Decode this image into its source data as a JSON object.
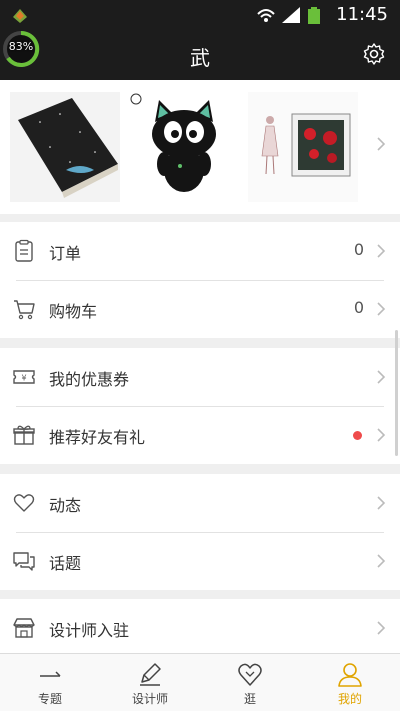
{
  "status_bar": {
    "time": "11:45",
    "battery_percent": "83%"
  },
  "header": {
    "title": "武"
  },
  "gallery": {
    "images": [
      "notebook-image",
      "black-cat-plush-image",
      "rose-frame-illustration-image"
    ]
  },
  "menu_groups": [
    {
      "items": [
        {
          "label": "订单",
          "count": "0"
        },
        {
          "label": "购物车",
          "count": "0"
        }
      ]
    },
    {
      "items": [
        {
          "label": "我的优惠券"
        },
        {
          "label": "推荐好友有礼",
          "badge": "red-dot"
        }
      ]
    },
    {
      "items": [
        {
          "label": "动态"
        },
        {
          "label": "话题"
        }
      ]
    },
    {
      "items": [
        {
          "label": "设计师入驻"
        }
      ]
    }
  ],
  "tabs": [
    {
      "label": "专题"
    },
    {
      "label": "设计师"
    },
    {
      "label": "逛"
    },
    {
      "label": "我的",
      "active": true
    }
  ],
  "colors": {
    "accent": "#e0a400",
    "badge": "#ef4b4b",
    "bar": "#1c1c1c"
  }
}
